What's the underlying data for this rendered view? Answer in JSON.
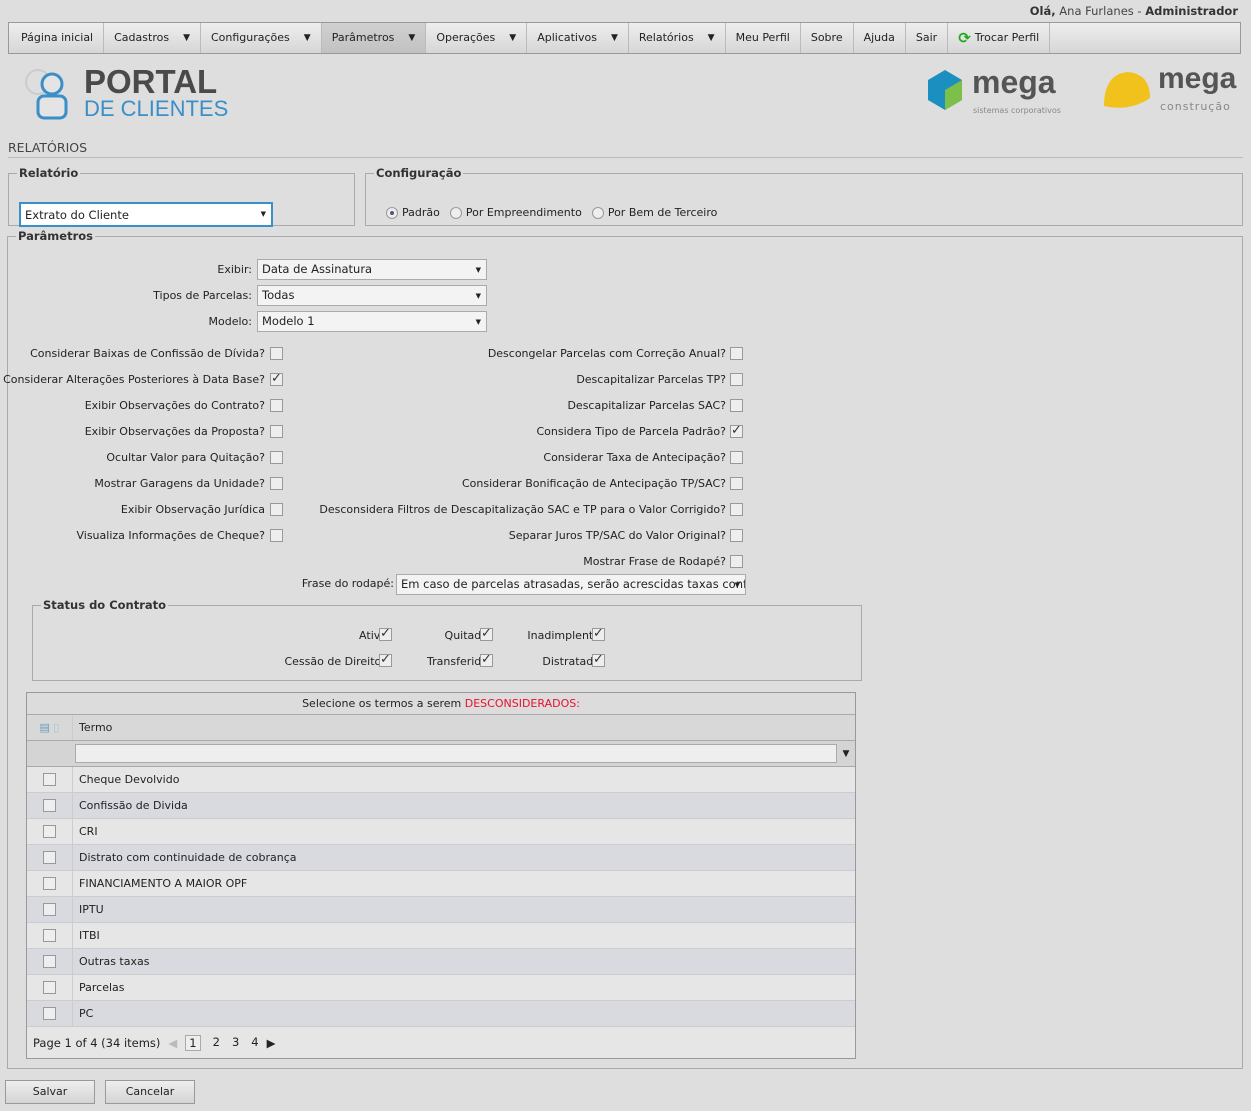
{
  "header": {
    "greeting": "Olá,",
    "user": "Ana Furlanes",
    "sep": "-",
    "role": "Administrador"
  },
  "nav": [
    {
      "label": "Página inicial",
      "dd": false
    },
    {
      "label": "Cadastros",
      "dd": true
    },
    {
      "label": "Configurações",
      "dd": true
    },
    {
      "label": "Parâmetros",
      "dd": true
    },
    {
      "label": "Operações",
      "dd": true
    },
    {
      "label": "Aplicativos",
      "dd": true
    },
    {
      "label": "Relatórios",
      "dd": true
    },
    {
      "label": "Meu Perfil",
      "dd": false
    },
    {
      "label": "Sobre",
      "dd": false
    },
    {
      "label": "Ajuda",
      "dd": false
    },
    {
      "label": "Sair",
      "dd": false
    },
    {
      "label": "Trocar Perfil",
      "dd": false
    }
  ],
  "logo": {
    "line1": "PORTAL",
    "line2": "DE CLIENTES",
    "mega1": "mega",
    "mega1_sub": "sistemas corporativos",
    "mega2": "mega",
    "mega2_sub": "construção"
  },
  "page_title": "RELATÓRIOS",
  "relatorio": {
    "legend": "Relatório",
    "value": "Extrato do Cliente"
  },
  "config": {
    "legend": "Configuração",
    "options": [
      "Padrão",
      "Por Empreendimento",
      "Por Bem de Terceiro"
    ],
    "selected": 0
  },
  "params": {
    "legend": "Parâmetros",
    "selects": [
      {
        "label": "Exibir:",
        "value": "Data de Assinatura"
      },
      {
        "label": "Tipos de Parcelas:",
        "value": "Todas"
      },
      {
        "label": "Modelo:",
        "value": "Modelo 1"
      }
    ],
    "left": [
      {
        "label": "Considerar Baixas de Confissão de Dívida?",
        "checked": false
      },
      {
        "label": "Considerar Alterações Posteriores à Data Base?",
        "checked": true
      },
      {
        "label": "Exibir Observações do Contrato?",
        "checked": false
      },
      {
        "label": "Exibir Observações da Proposta?",
        "checked": false
      },
      {
        "label": "Ocultar Valor para Quitação?",
        "checked": false
      },
      {
        "label": "Mostrar Garagens da Unidade?",
        "checked": false
      },
      {
        "label": "Exibir Observação Jurídica",
        "checked": false
      },
      {
        "label": "Visualiza Informações de Cheque?",
        "checked": false
      }
    ],
    "right": [
      {
        "label": "Descongelar Parcelas com Correção Anual?",
        "checked": false
      },
      {
        "label": "Descapitalizar Parcelas TP?",
        "checked": false
      },
      {
        "label": "Descapitalizar Parcelas SAC?",
        "checked": false
      },
      {
        "label": "Considera Tipo de Parcela Padrão?",
        "checked": true
      },
      {
        "label": "Considerar Taxa de Antecipação?",
        "checked": false
      },
      {
        "label": "Considerar Bonificação de Antecipação TP/SAC?",
        "checked": false
      },
      {
        "label": "Desconsidera Filtros de Descapitalização SAC e TP para o Valor Corrigido?",
        "checked": false
      },
      {
        "label": "Separar Juros TP/SAC do Valor Original?",
        "checked": false
      },
      {
        "label": "Mostrar Frase de Rodapé?",
        "checked": false
      }
    ],
    "footer_label": "Frase do rodapé:",
    "footer_value": "Em caso de parcelas atrasadas, serão acrescidas taxas confor"
  },
  "status": {
    "legend": "Status do Contrato",
    "items": [
      {
        "label": "Ativo",
        "checked": true
      },
      {
        "label": "Quitado",
        "checked": true
      },
      {
        "label": "Inadimplente",
        "checked": true
      },
      {
        "label": "Cessão de Direitos",
        "checked": true
      },
      {
        "label": "Transferido",
        "checked": true
      },
      {
        "label": "Distratado",
        "checked": true
      }
    ]
  },
  "grid": {
    "caption": "Selecione os termos a serem ",
    "caption_red": "DESCONSIDERADOS:",
    "column": "Termo",
    "rows": [
      "Cheque Devolvido",
      "Confissão de Divida",
      "CRI",
      "Distrato com continuidade de cobrança",
      "FINANCIAMENTO A MAIOR OPF",
      "IPTU",
      "ITBI",
      "Outras taxas",
      "Parcelas",
      "PC"
    ],
    "pager": {
      "summary": "Page 1 of 4 (34 items)",
      "pages": [
        "1",
        "2",
        "3",
        "4"
      ],
      "current": "1"
    }
  },
  "buttons": {
    "save": "Salvar",
    "cancel": "Cancelar"
  },
  "colors": {
    "red": "#e8102b",
    "logo_dark": "#4a4a4a",
    "logo_blue": "#3a8fc8"
  }
}
